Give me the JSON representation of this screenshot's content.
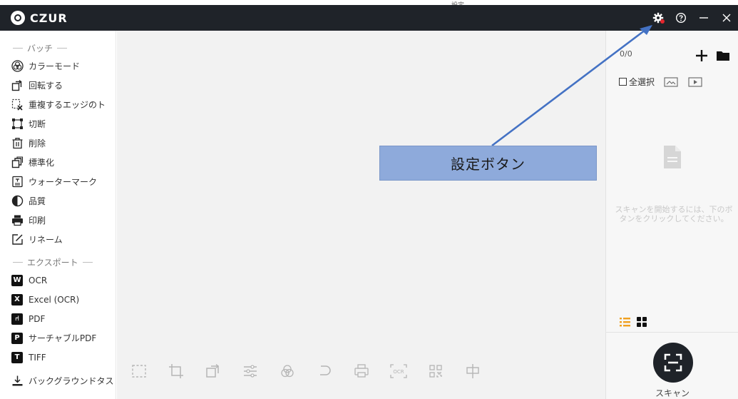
{
  "app": {
    "logo_text": "CZUR",
    "top_strip_text": "設定"
  },
  "window_controls": [
    {
      "name": "settings-button",
      "icon": "gear-icon"
    },
    {
      "name": "help-button",
      "icon": "question-circle-icon"
    },
    {
      "name": "minimize-button",
      "icon": "minus-icon"
    },
    {
      "name": "close-button",
      "icon": "close-icon"
    }
  ],
  "sidebar": {
    "batch_header": "バッチ",
    "batch_items": [
      {
        "label": "カラーモード",
        "icon": "color-mode-icon"
      },
      {
        "label": "回転する",
        "icon": "rotate-icon"
      },
      {
        "label": "重複するエッジのト",
        "icon": "overlap-edge-icon"
      },
      {
        "label": "切断",
        "icon": "cut-icon"
      },
      {
        "label": "削除",
        "icon": "trash-icon"
      },
      {
        "label": "標準化",
        "icon": "standardize-icon"
      },
      {
        "label": "ウォーターマーク",
        "icon": "watermark-icon"
      },
      {
        "label": "品質",
        "icon": "quality-icon"
      },
      {
        "label": "印刷",
        "icon": "printer-icon"
      },
      {
        "label": "リネーム",
        "icon": "rename-icon"
      }
    ],
    "export_header": "エクスポート",
    "export_items": [
      {
        "label": "OCR",
        "badge": "W",
        "icon": "word-icon"
      },
      {
        "label": "Excel (OCR)",
        "badge": "X",
        "icon": "excel-icon"
      },
      {
        "label": "PDF",
        "badge": "⑁",
        "icon": "pdf-icon"
      },
      {
        "label": "サーチャブルPDF",
        "badge": "P",
        "icon": "searchable-pdf-icon"
      },
      {
        "label": "TIFF",
        "badge": "T",
        "icon": "tiff-icon"
      }
    ],
    "background_task_label": "バックグラウンドタス"
  },
  "toolbar": {
    "tools": [
      "crop-select-icon",
      "crop-icon",
      "rotate-crop-icon",
      "adjust-icon",
      "color-icon",
      "undo-icon",
      "print-icon",
      "ocr-icon",
      "qr-code-icon",
      "split-icon"
    ],
    "ocr_text": "OCR"
  },
  "callout": {
    "text": "設定ボタン"
  },
  "right_panel": {
    "page_count": "0/0",
    "select_all_label": "全選択",
    "empty_message": "スキャンを開始するには、下のボタンをクリックしてください。",
    "scan_label": "スキャン"
  },
  "colors": {
    "titlebar": "#1f2329",
    "callout_fill": "#8eaadb",
    "arrow": "#4472c4",
    "notify_dot": "#e3262d",
    "list_view": "#f0a020"
  }
}
